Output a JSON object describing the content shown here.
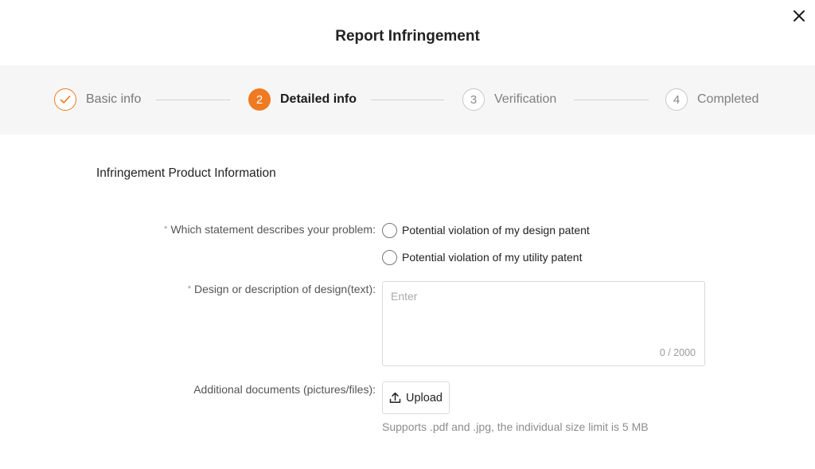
{
  "modal": {
    "title": "Report Infringement",
    "close_icon": "close-icon"
  },
  "steps": [
    {
      "number": "1",
      "label": "Basic info",
      "state": "done",
      "icon": "check-icon"
    },
    {
      "number": "2",
      "label": "Detailed info",
      "state": "active"
    },
    {
      "number": "3",
      "label": "Verification",
      "state": "pending"
    },
    {
      "number": "4",
      "label": "Completed",
      "state": "pending"
    }
  ],
  "section": {
    "title": "Infringement Product Information"
  },
  "form": {
    "problem": {
      "label": "Which statement describes your problem:",
      "required_mark": "*",
      "options": [
        "Potential violation of my design patent",
        "Potential violation of my utility patent"
      ]
    },
    "design": {
      "label": "Design or description of design(text):",
      "required_mark": "*",
      "placeholder": "Enter",
      "char_count": "0 / 2000"
    },
    "documents": {
      "label": "Additional documents (pictures/files):",
      "upload_label": "Upload",
      "upload_icon": "upload-icon",
      "hint": "Supports .pdf and .jpg, the individual size limit is 5 MB"
    }
  },
  "colors": {
    "accent": "#f07a21",
    "steps_background": "#f6f6f6"
  }
}
